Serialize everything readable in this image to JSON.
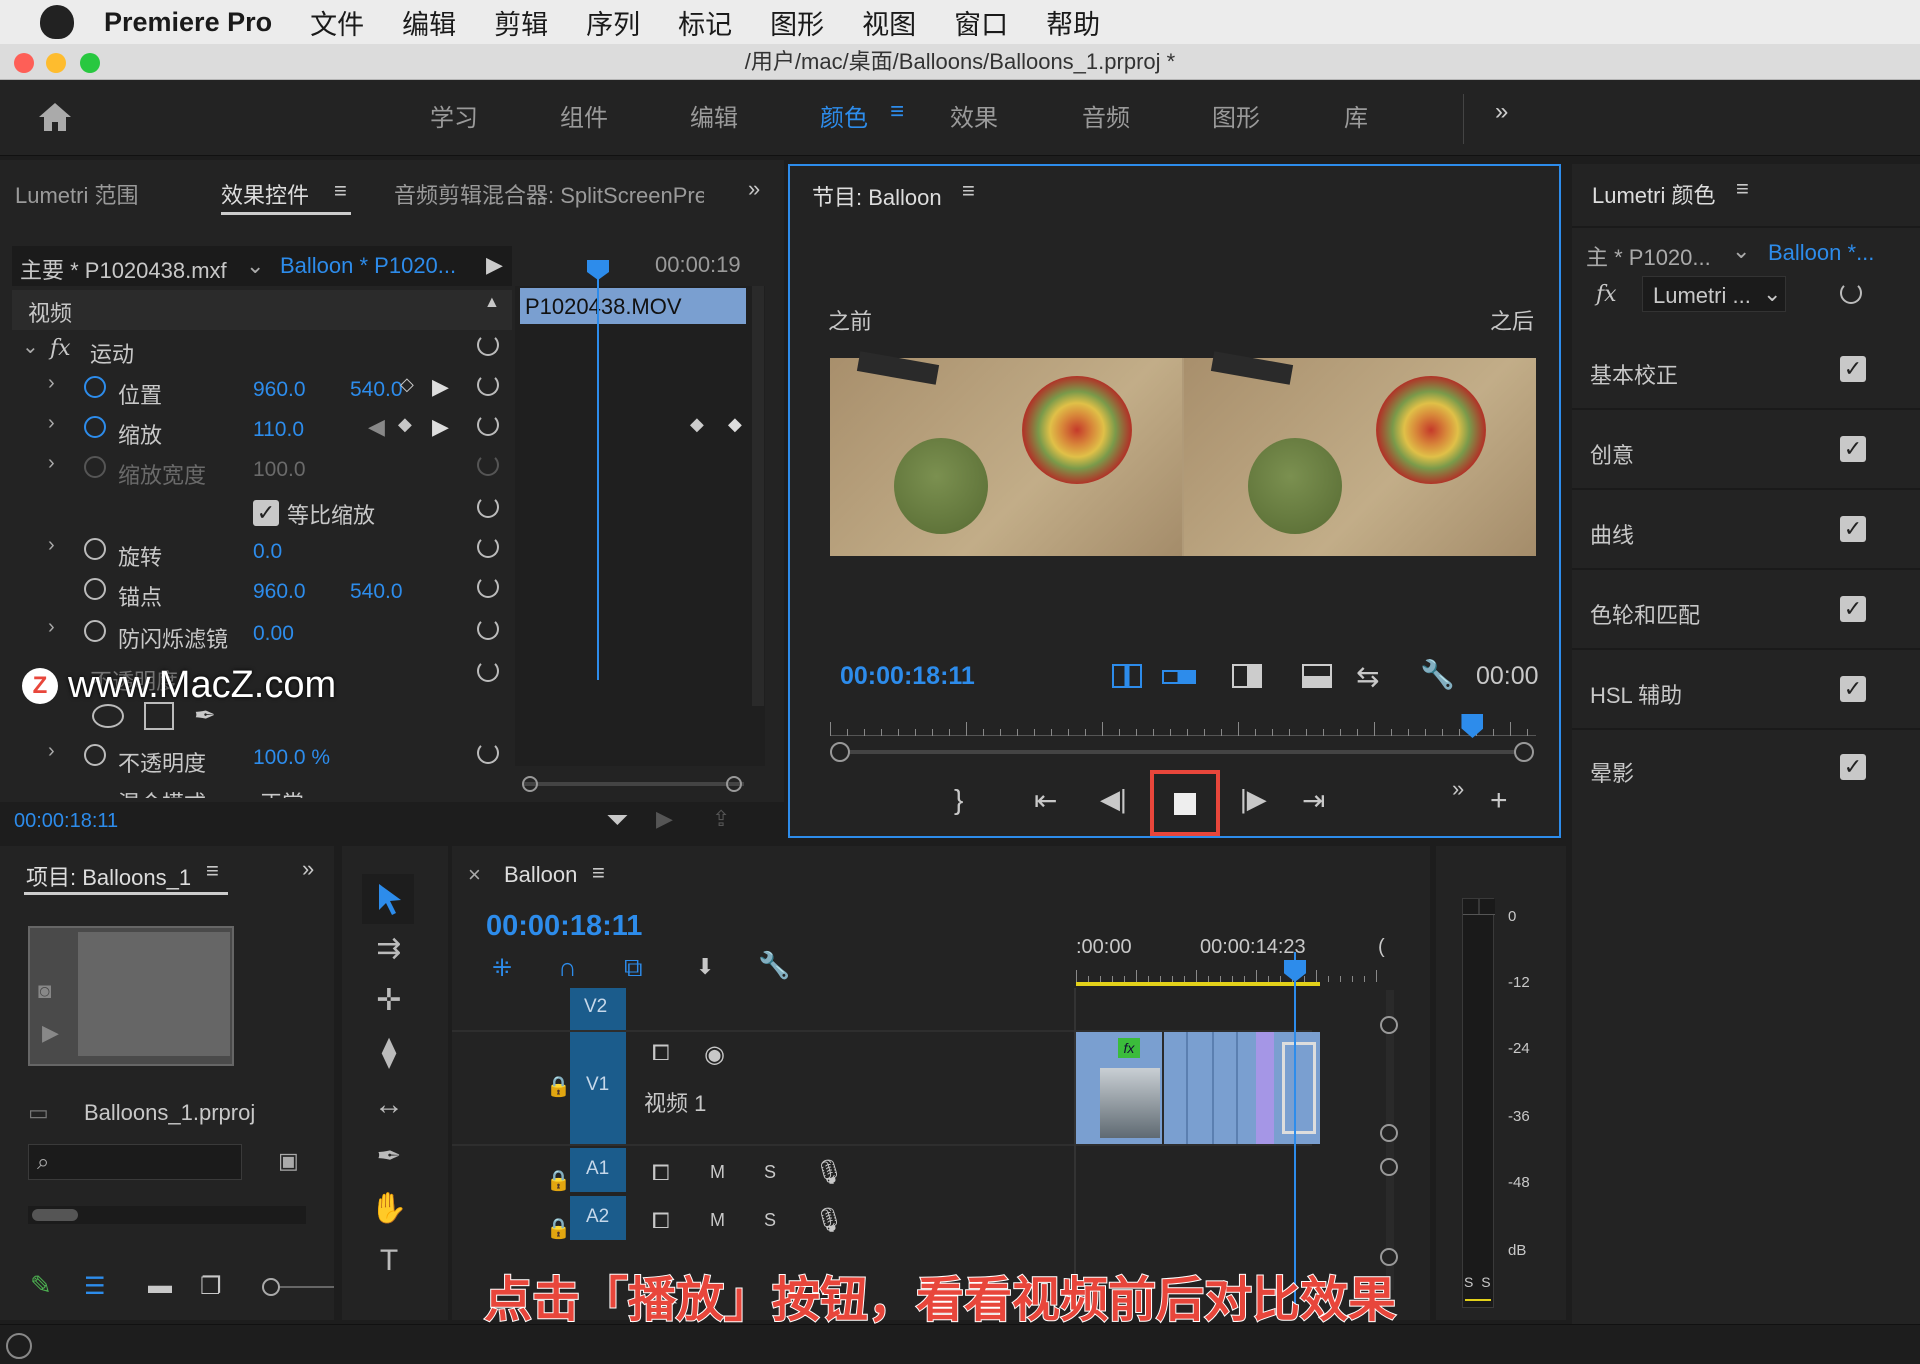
{
  "menubar": {
    "app": "Premiere Pro",
    "items": [
      "文件",
      "编辑",
      "剪辑",
      "序列",
      "标记",
      "图形",
      "视图",
      "窗口",
      "帮助"
    ]
  },
  "window": {
    "title": "/用户/mac/桌面/Balloons/Balloons_1.prproj *"
  },
  "workspaces": {
    "items": [
      "学习",
      "组件",
      "编辑",
      "颜色",
      "效果",
      "音频",
      "图形",
      "库"
    ],
    "active": "颜色",
    "more": "»"
  },
  "effect_controls": {
    "tab_scope": "Lumetri 范围",
    "tab_fx": "效果控件",
    "tab_mixer": "音频剪辑混合器: SplitScreenPre",
    "more": "»",
    "master": "主要 * P1020438.mxf",
    "sequence": "Balloon * P1020...",
    "timecode_ruler": "00:00:19",
    "clip": "P1020438.MOV",
    "video_section": "视频",
    "motion": "运动",
    "position_label": "位置",
    "position_x": "960.0",
    "position_y": "540.0",
    "scale_label": "缩放",
    "scale": "110.0",
    "scale_width_label": "缩放宽度",
    "scale_width": "100.0",
    "uniform_label": "等比缩放",
    "rotation_label": "旋转",
    "rotation": "0.0",
    "anchor_label": "锚点",
    "anchor_x": "960.0",
    "anchor_y": "540.0",
    "flicker_label": "防闪烁滤镜",
    "flicker": "0.00",
    "opacity_section": "不透明度",
    "opacity_label": "不透明度",
    "opacity": "100.0 %",
    "blend_label": "混合模式",
    "blend": "正常",
    "current_time": "00:00:18:11"
  },
  "watermark": "www.MacZ.com",
  "program": {
    "title": "节目: Balloon",
    "before": "之前",
    "after": "之后",
    "timecode": "00:00:18:11",
    "duration": "00:00",
    "playhead_fraction": 0.91
  },
  "lumetri": {
    "title": "Lumetri 颜色",
    "master": "主 * P1020...",
    "sequence": "Balloon *...",
    "fx_select": "Lumetri ...",
    "sections": [
      "基本校正",
      "创意",
      "曲线",
      "色轮和匹配",
      "HSL 辅助",
      "晕影"
    ]
  },
  "project": {
    "title": "项目: Balloons_1",
    "file": "Balloons_1.prproj",
    "more": "»"
  },
  "timeline": {
    "title": "Balloon",
    "timecode": "00:00:18:11",
    "ruler_start": ":00:00",
    "ruler_mid": "00:00:14:23",
    "ruler_end": "(",
    "tracks": {
      "v2": "V2",
      "v1": "V1",
      "v1_name": "视频 1",
      "a1": "A1",
      "a2": "A2",
      "m": "M",
      "s": "S"
    },
    "fx_badge": "fx"
  },
  "meter": {
    "labels": [
      "0",
      "-12",
      "-24",
      "-36",
      "-48",
      "dB"
    ],
    "solo": "S S"
  },
  "caption": "点击「播放」按钮，看看视频前后对比效果",
  "colors": {
    "accent": "#2d8ceb",
    "clip_blue": "#7a9fd0",
    "clip_purple": "#a596e6",
    "highlight": "#e8463b"
  }
}
